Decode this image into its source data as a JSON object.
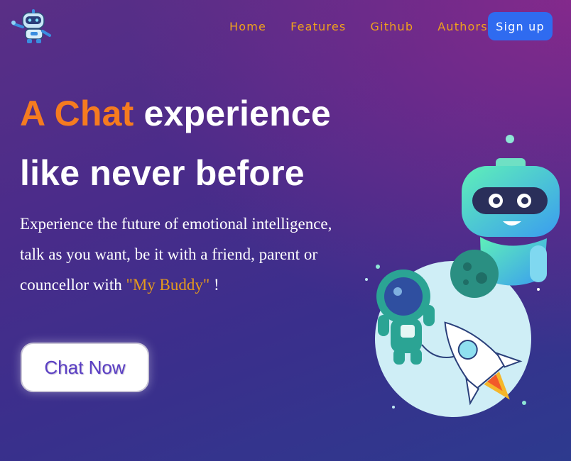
{
  "nav": {
    "links": [
      "Home",
      "Features",
      "Github",
      "Authors"
    ],
    "signup_label": "Sign up",
    "logo_icon": "robot-logo-icon",
    "link_color": "#f0a21c",
    "signup_color": "#2f6bf0"
  },
  "hero": {
    "headline_accent": "A Chat",
    "headline_rest": " experience",
    "headline_line2": "like never before",
    "subtitle_text": "Experience the future of emotional intelligence, talk as you want, be it with a friend, parent or councellor with ",
    "subtitle_quote": "\"My Buddy\"",
    "subtitle_end": " !",
    "accent_color": "#f57b20",
    "cta_label": "Chat Now"
  },
  "illustration": {
    "icon": "robot-astronaut-rocket-illustration"
  }
}
